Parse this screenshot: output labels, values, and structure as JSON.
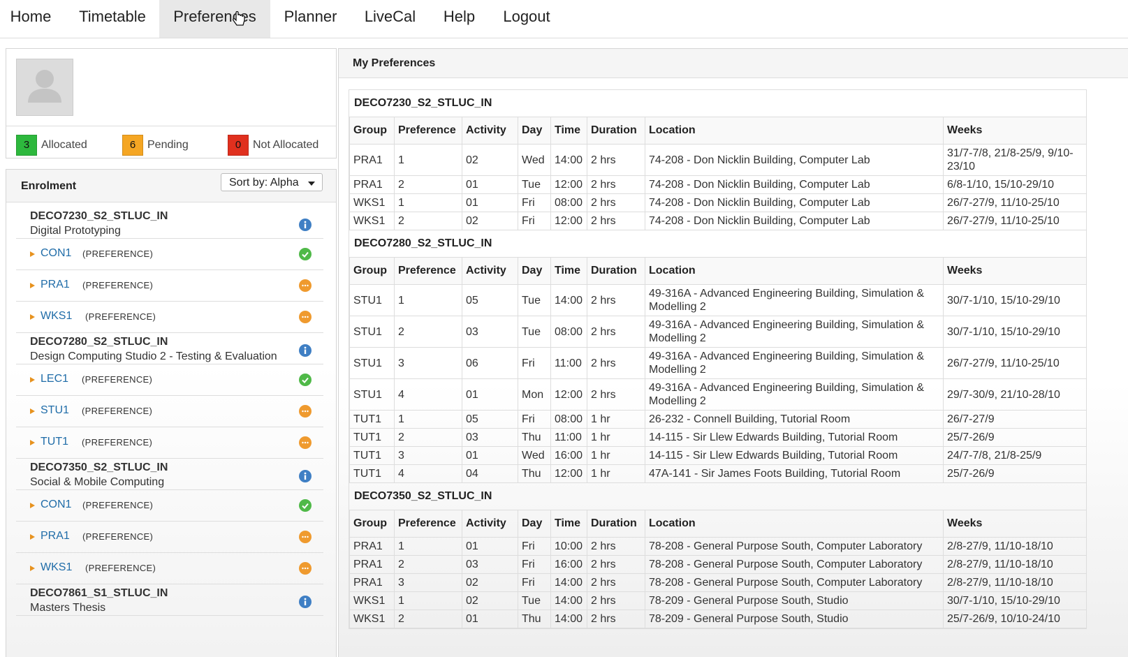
{
  "nav": {
    "items": [
      "Home",
      "Timetable",
      "Preferences",
      "Planner",
      "LiveCal",
      "Help",
      "Logout"
    ],
    "active": "Preferences"
  },
  "profile": {
    "allocated_count": "3",
    "allocated_label": "Allocated",
    "pending_count": "6",
    "pending_label": "Pending",
    "not_allocated_count": "0",
    "not_allocated_label": "Not Allocated",
    "colors": {
      "allocated": "#2db83d",
      "pending": "#f5a623",
      "not_allocated": "#e0301e"
    }
  },
  "enrolment": {
    "title": "Enrolment",
    "sort_label": "Sort by: Alpha",
    "courses": [
      {
        "code": "DECO7230_S2_STLUC_IN",
        "name": "Digital Prototyping",
        "activities": [
          {
            "code": "CON1",
            "label": "(PREFERENCE)",
            "state": "ok"
          },
          {
            "code": "PRA1",
            "label": "(PREFERENCE)",
            "state": "pend"
          },
          {
            "code": "WKS1",
            "label": "(PREFERENCE)",
            "state": "pend"
          }
        ]
      },
      {
        "code": "DECO7280_S2_STLUC_IN",
        "name": "Design Computing Studio 2 - Testing & Evaluation",
        "activities": [
          {
            "code": "LEC1",
            "label": "(PREFERENCE)",
            "state": "ok"
          },
          {
            "code": "STU1",
            "label": "(PREFERENCE)",
            "state": "pend"
          },
          {
            "code": "TUT1",
            "label": "(PREFERENCE)",
            "state": "pend"
          }
        ]
      },
      {
        "code": "DECO7350_S2_STLUC_IN",
        "name": "Social & Mobile Computing",
        "activities": [
          {
            "code": "CON1",
            "label": "(PREFERENCE)",
            "state": "ok"
          },
          {
            "code": "PRA1",
            "label": "(PREFERENCE)",
            "state": "pend"
          },
          {
            "code": "WKS1",
            "label": "(PREFERENCE)",
            "state": "pend"
          }
        ]
      },
      {
        "code": "DECO7861_S1_STLUC_IN",
        "name": "Masters Thesis",
        "activities": []
      }
    ]
  },
  "preferences": {
    "title": "My Preferences",
    "columns": [
      "Group",
      "Preference",
      "Activity",
      "Day",
      "Time",
      "Duration",
      "Location",
      "Weeks"
    ],
    "courses": [
      {
        "code": "DECO7230_S2_STLUC_IN",
        "rows": [
          [
            "PRA1",
            "1",
            "02",
            "Wed",
            "14:00",
            "2 hrs",
            "74-208 - Don Nicklin Building, Computer Lab",
            "31/7-7/8, 21/8-25/9, 9/10-23/10"
          ],
          [
            "PRA1",
            "2",
            "01",
            "Tue",
            "12:00",
            "2 hrs",
            "74-208 - Don Nicklin Building, Computer Lab",
            "6/8-1/10, 15/10-29/10"
          ],
          [
            "WKS1",
            "1",
            "01",
            "Fri",
            "08:00",
            "2 hrs",
            "74-208 - Don Nicklin Building, Computer Lab",
            "26/7-27/9, 11/10-25/10"
          ],
          [
            "WKS1",
            "2",
            "02",
            "Fri",
            "12:00",
            "2 hrs",
            "74-208 - Don Nicklin Building, Computer Lab",
            "26/7-27/9, 11/10-25/10"
          ]
        ]
      },
      {
        "code": "DECO7280_S2_STLUC_IN",
        "rows": [
          [
            "STU1",
            "1",
            "05",
            "Tue",
            "14:00",
            "2 hrs",
            "49-316A - Advanced Engineering Building, Simulation & Modelling 2",
            "30/7-1/10, 15/10-29/10"
          ],
          [
            "STU1",
            "2",
            "03",
            "Tue",
            "08:00",
            "2 hrs",
            "49-316A - Advanced Engineering Building, Simulation & Modelling 2",
            "30/7-1/10, 15/10-29/10"
          ],
          [
            "STU1",
            "3",
            "06",
            "Fri",
            "11:00",
            "2 hrs",
            "49-316A - Advanced Engineering Building, Simulation & Modelling 2",
            "26/7-27/9, 11/10-25/10"
          ],
          [
            "STU1",
            "4",
            "01",
            "Mon",
            "12:00",
            "2 hrs",
            "49-316A - Advanced Engineering Building, Simulation & Modelling 2",
            "29/7-30/9, 21/10-28/10"
          ],
          [
            "TUT1",
            "1",
            "05",
            "Fri",
            "08:00",
            "1 hr",
            "26-232 - Connell Building, Tutorial Room",
            "26/7-27/9"
          ],
          [
            "TUT1",
            "2",
            "03",
            "Thu",
            "11:00",
            "1 hr",
            "14-115 - Sir Llew Edwards Building, Tutorial Room",
            "25/7-26/9"
          ],
          [
            "TUT1",
            "3",
            "01",
            "Wed",
            "16:00",
            "1 hr",
            "14-115 - Sir Llew Edwards Building, Tutorial Room",
            "24/7-7/8, 21/8-25/9"
          ],
          [
            "TUT1",
            "4",
            "04",
            "Thu",
            "12:00",
            "1 hr",
            "47A-141 - Sir James Foots Building, Tutorial Room",
            "25/7-26/9"
          ]
        ]
      },
      {
        "code": "DECO7350_S2_STLUC_IN",
        "rows": [
          [
            "PRA1",
            "1",
            "01",
            "Fri",
            "10:00",
            "2 hrs",
            "78-208 - General Purpose South, Computer Laboratory",
            "2/8-27/9, 11/10-18/10"
          ],
          [
            "PRA1",
            "2",
            "03",
            "Fri",
            "16:00",
            "2 hrs",
            "78-208 - General Purpose South, Computer Laboratory",
            "2/8-27/9, 11/10-18/10"
          ],
          [
            "PRA1",
            "3",
            "02",
            "Fri",
            "14:00",
            "2 hrs",
            "78-208 - General Purpose South, Computer Laboratory",
            "2/8-27/9, 11/10-18/10"
          ],
          [
            "WKS1",
            "1",
            "02",
            "Tue",
            "14:00",
            "2 hrs",
            "78-209 - General Purpose South, Studio",
            "30/7-1/10, 15/10-29/10"
          ],
          [
            "WKS1",
            "2",
            "01",
            "Thu",
            "14:00",
            "2 hrs",
            "78-209 - General Purpose South, Studio",
            "25/7-26/9, 10/10-24/10"
          ]
        ]
      }
    ]
  }
}
